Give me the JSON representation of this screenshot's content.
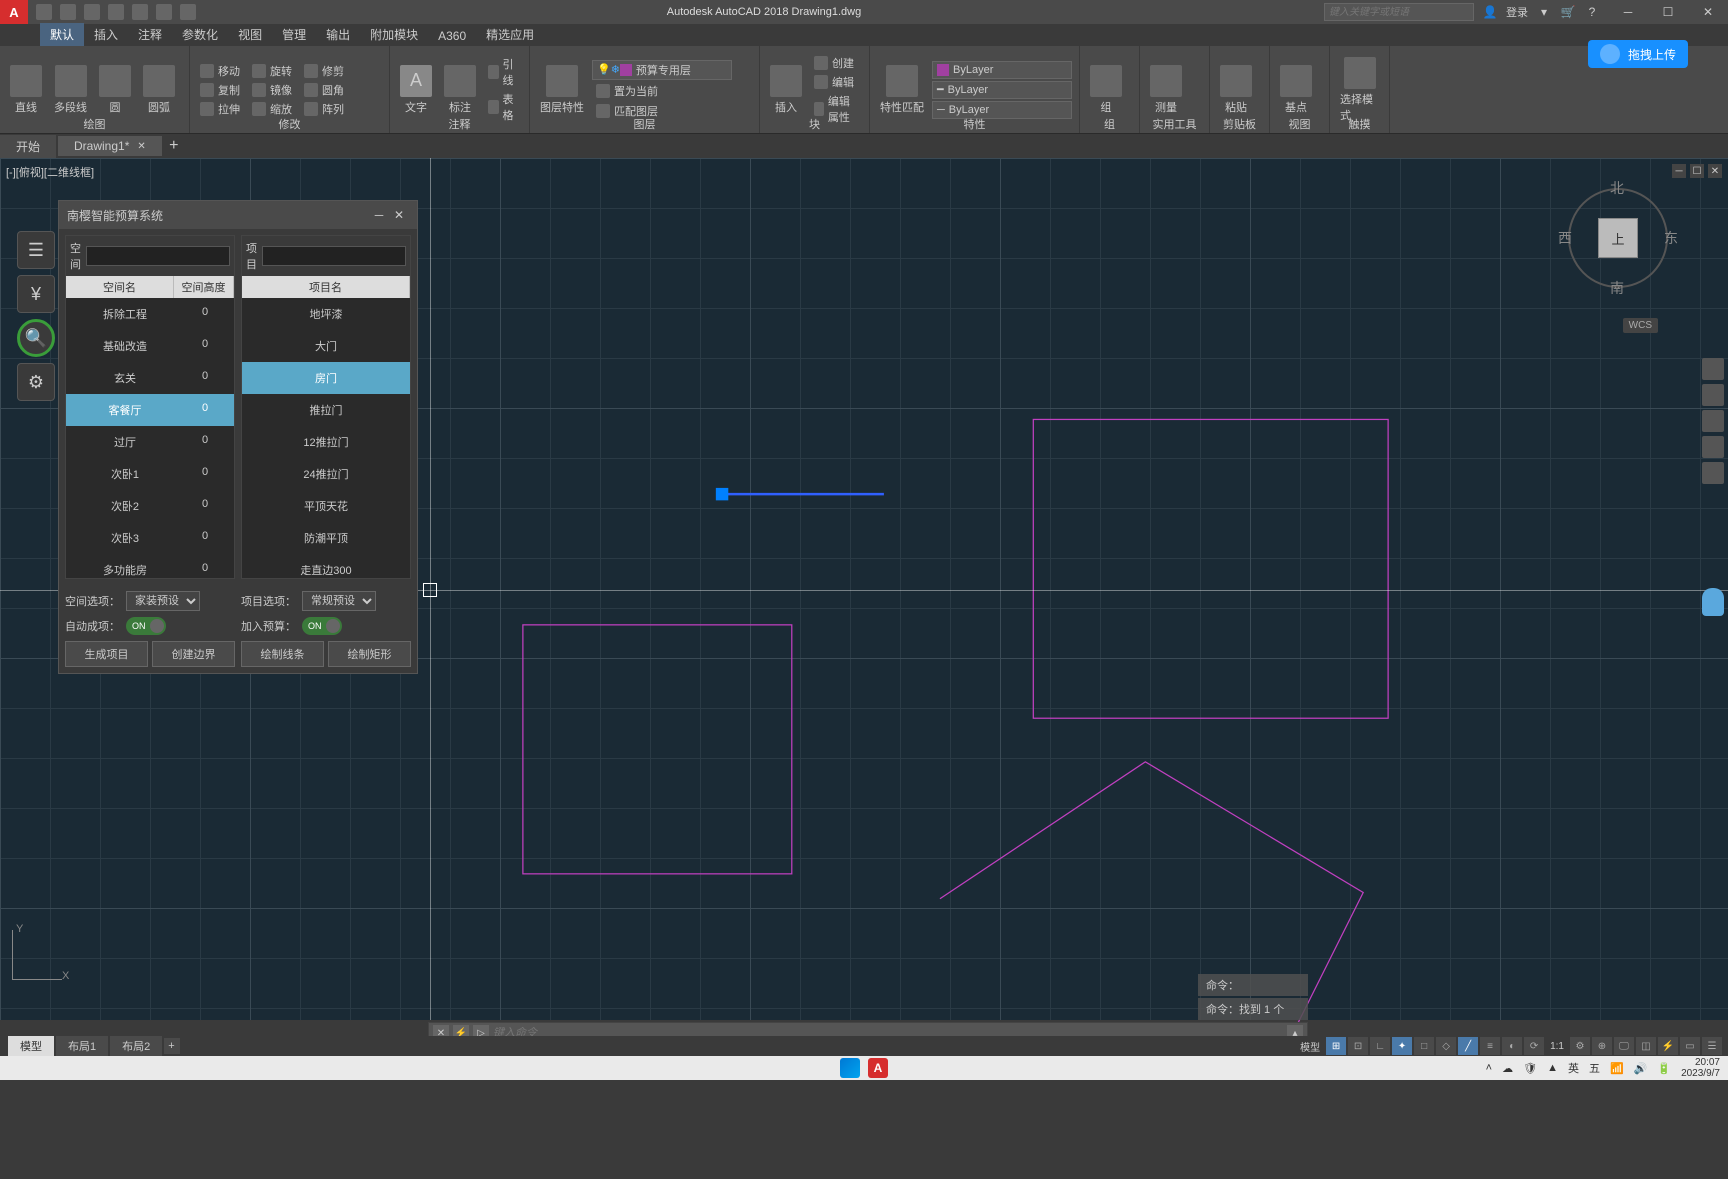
{
  "titlebar": {
    "app_title": "Autodesk AutoCAD 2018   Drawing1.dwg",
    "search_placeholder": "键入关键字或短语",
    "login": "登录"
  },
  "ribbon": {
    "tabs": [
      "默认",
      "插入",
      "注释",
      "参数化",
      "视图",
      "管理",
      "输出",
      "附加模块",
      "A360",
      "精选应用"
    ],
    "active_tab": 0,
    "panels": {
      "draw": {
        "title": "绘图",
        "items": [
          "直线",
          "多段线",
          "圆",
          "圆弧"
        ]
      },
      "modify": {
        "title": "修改",
        "items": [
          [
            "移动",
            "复制",
            "拉伸"
          ],
          [
            "旋转",
            "镜像",
            "缩放"
          ],
          [
            "修剪",
            "圆角",
            "阵列"
          ]
        ]
      },
      "annot": {
        "title": "注释",
        "items": [
          "文字",
          "标注",
          "引线",
          "表格"
        ]
      },
      "layers": {
        "title": "图层",
        "props": "图层特性",
        "current": "预算专用层",
        "buttons": [
          "置为当前",
          "匹配图层"
        ]
      },
      "block": {
        "title": "块",
        "insert": "插入",
        "items": [
          "创建",
          "编辑",
          "编辑属性"
        ]
      },
      "props": {
        "title": "特性",
        "match": "特性匹配",
        "bylayer": "ByLayer"
      },
      "group": {
        "title": "组",
        "label": "组"
      },
      "util": {
        "title": "实用工具",
        "label": "测量"
      },
      "clip": {
        "title": "剪贴板",
        "label": "粘贴"
      },
      "view": {
        "title": "视图",
        "label": "基点"
      },
      "sel": {
        "title": "触摸",
        "label": "选择模式"
      }
    }
  },
  "upload": {
    "label": "拖拽上传"
  },
  "doc_tabs": {
    "start": "开始",
    "drawing": "Drawing1*"
  },
  "view_label": "[-][俯视][二维线框]",
  "compass": {
    "n": "北",
    "s": "南",
    "e": "东",
    "w": "西",
    "top": "上",
    "wcs": "WCS"
  },
  "ucs": {
    "x": "X",
    "y": "Y"
  },
  "plugin": {
    "title": "南樱智能预算系统",
    "space_label": "空间",
    "project_label": "项目",
    "space_headers": [
      "空间名",
      "空间高度"
    ],
    "project_header": "项目名",
    "spaces": [
      {
        "name": "拆除工程",
        "h": "0"
      },
      {
        "name": "基础改造",
        "h": "0"
      },
      {
        "name": "玄关",
        "h": "0"
      },
      {
        "name": "客餐厅",
        "h": "0",
        "selected": true
      },
      {
        "name": "过厅",
        "h": "0"
      },
      {
        "name": "次卧1",
        "h": "0"
      },
      {
        "name": "次卧2",
        "h": "0"
      },
      {
        "name": "次卧3",
        "h": "0"
      },
      {
        "name": "多功能房",
        "h": "0"
      }
    ],
    "projects": [
      {
        "name": "地坪漆"
      },
      {
        "name": "大门"
      },
      {
        "name": "房门",
        "selected": true
      },
      {
        "name": "推拉门"
      },
      {
        "name": "12推拉门"
      },
      {
        "name": "24推拉门"
      },
      {
        "name": "平顶天花"
      },
      {
        "name": "防潮平顶"
      },
      {
        "name": "走直边300"
      }
    ],
    "space_opt_label": "空间选项：",
    "space_opt_value": "家装预设",
    "project_opt_label": "项目选项：",
    "project_opt_value": "常规预设",
    "auto_label": "自动成项：",
    "budget_label": "加入预算：",
    "on": "ON",
    "gen_project": "生成项目",
    "create_boundary": "创建边界",
    "draw_line": "绘制线条",
    "draw_rect": "绘制矩形"
  },
  "cmd": {
    "history1": "命令：",
    "history2": "命令：找到  1 个",
    "placeholder": "键入命令"
  },
  "model_tabs": [
    "模型",
    "布局1",
    "布局2"
  ],
  "status": {
    "model": "模型",
    "ratio": "1:1"
  },
  "taskbar": {
    "ime": [
      "英",
      "五"
    ],
    "time": "20:07",
    "date": "2023/9/7"
  }
}
